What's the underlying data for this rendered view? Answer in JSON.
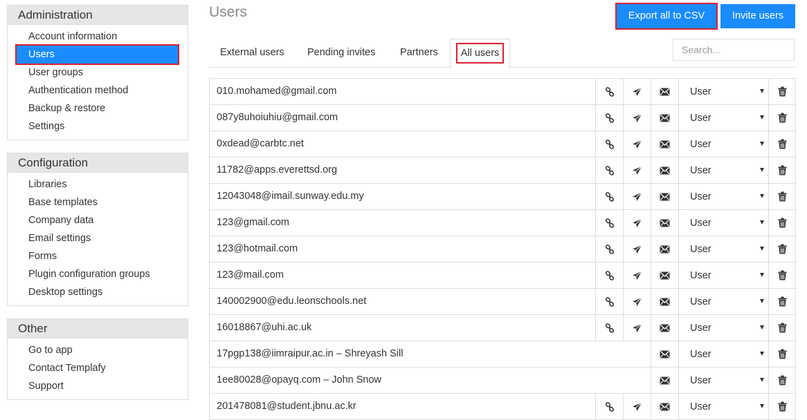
{
  "sidebar": {
    "administration": {
      "title": "Administration",
      "items": [
        "Account information",
        "Users",
        "User groups",
        "Authentication method",
        "Backup & restore",
        "Settings"
      ],
      "active_index": 1
    },
    "configuration": {
      "title": "Configuration",
      "items": [
        "Libraries",
        "Base templates",
        "Company data",
        "Email settings",
        "Forms",
        "Plugin configuration groups",
        "Desktop settings"
      ]
    },
    "other": {
      "title": "Other",
      "items": [
        "Go to app",
        "Contact Templafy",
        "Support"
      ]
    }
  },
  "header": {
    "title": "Users",
    "export_label": "Export all to CSV",
    "invite_label": "Invite users"
  },
  "tabs": [
    "External users",
    "Pending invites",
    "Partners",
    "All users"
  ],
  "active_tab": "All users",
  "search": {
    "placeholder": "Search...",
    "value": ""
  },
  "role_options": [
    "User"
  ],
  "users": [
    {
      "email": "010.mohamed@gmail.com",
      "link": true,
      "role": "User"
    },
    {
      "email": "087y8uhoiuhiu@gmail.com",
      "link": true,
      "role": "User"
    },
    {
      "email": "0xdead@carbtc.net",
      "link": true,
      "role": "User"
    },
    {
      "email": "11782@apps.everettsd.org",
      "link": true,
      "role": "User"
    },
    {
      "email": "12043048@imail.sunway.edu.my",
      "link": true,
      "role": "User"
    },
    {
      "email": "123@gmail.com",
      "link": true,
      "role": "User"
    },
    {
      "email": "123@hotmail.com",
      "link": true,
      "role": "User"
    },
    {
      "email": "123@mail.com",
      "link": true,
      "role": "User"
    },
    {
      "email": "140002900@edu.leonschools.net",
      "link": true,
      "role": "User"
    },
    {
      "email": "16018867@uhi.ac.uk",
      "link": true,
      "role": "User"
    },
    {
      "email": "17pgp138@iimraipur.ac.in – Shreyash Sill",
      "link": false,
      "role": "User"
    },
    {
      "email": "1ee80028@opayq.com – John Snow",
      "link": false,
      "role": "User"
    },
    {
      "email": "201478081@student.jbnu.ac.kr",
      "link": true,
      "role": "User"
    }
  ],
  "colors": {
    "accent": "#1a8cff",
    "highlight": "#d92030",
    "panel_header": "#e6e6e6"
  },
  "icons": {
    "link": "link-icon",
    "send": "paper-plane-icon",
    "mail": "envelope-icon",
    "delete": "trash-icon",
    "dropdown": "chevron-down-icon"
  }
}
